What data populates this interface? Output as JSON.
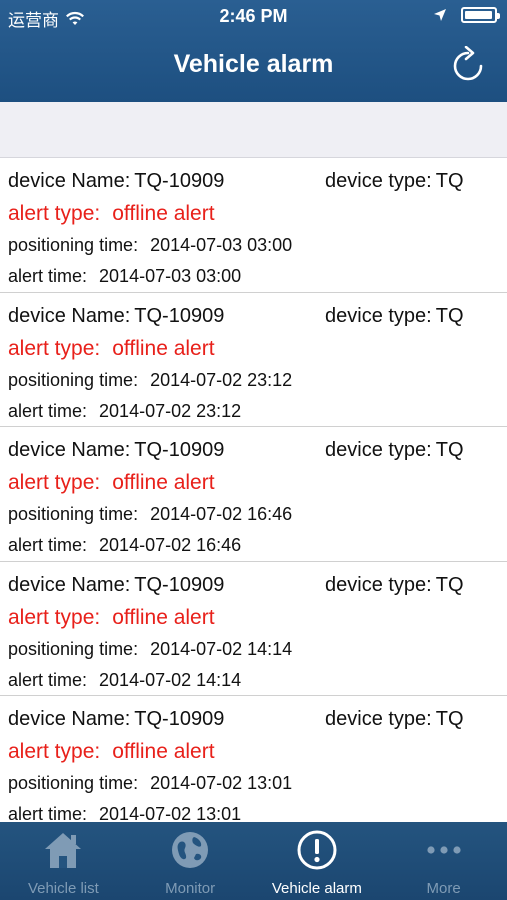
{
  "status_bar": {
    "carrier": "运营商",
    "time": "2:46 PM",
    "battery_level": 0.95
  },
  "header": {
    "title": "Vehicle alarm",
    "refresh_icon": "refresh-icon"
  },
  "labels": {
    "device_name": "device Name:",
    "device_type": "device type:",
    "alert_type": "alert type:",
    "positioning_time": "positioning time:",
    "alert_time": "alert time:"
  },
  "alarms": [
    {
      "device_name": "TQ-10909",
      "device_type": "TQ",
      "alert_type": "offline alert",
      "positioning_time": "2014-07-03 03:00",
      "alert_time": "2014-07-03 03:00"
    },
    {
      "device_name": "TQ-10909",
      "device_type": "TQ",
      "alert_type": "offline alert",
      "positioning_time": "2014-07-02 23:12",
      "alert_time": "2014-07-02 23:12"
    },
    {
      "device_name": "TQ-10909",
      "device_type": "TQ",
      "alert_type": "offline alert",
      "positioning_time": "2014-07-02 16:46",
      "alert_time": "2014-07-02 16:46"
    },
    {
      "device_name": "TQ-10909",
      "device_type": "TQ",
      "alert_type": "offline alert",
      "positioning_time": "2014-07-02 14:14",
      "alert_time": "2014-07-02 14:14"
    },
    {
      "device_name": "TQ-10909",
      "device_type": "TQ",
      "alert_type": "offline alert",
      "positioning_time": "2014-07-02 13:01",
      "alert_time": "2014-07-02 13:01"
    }
  ],
  "tabs": [
    {
      "label": "Vehicle list",
      "icon": "house-icon",
      "active": false
    },
    {
      "label": "Monitor",
      "icon": "globe-icon",
      "active": false
    },
    {
      "label": "Vehicle alarm",
      "icon": "alert-icon",
      "active": true
    },
    {
      "label": "More",
      "icon": "more-dots-icon",
      "active": false
    }
  ],
  "colors": {
    "nav_bar": "#1d4f80",
    "alert_red": "#e8201a",
    "tab_active": "#ffffff",
    "tab_inactive": "#7f9bb5"
  }
}
